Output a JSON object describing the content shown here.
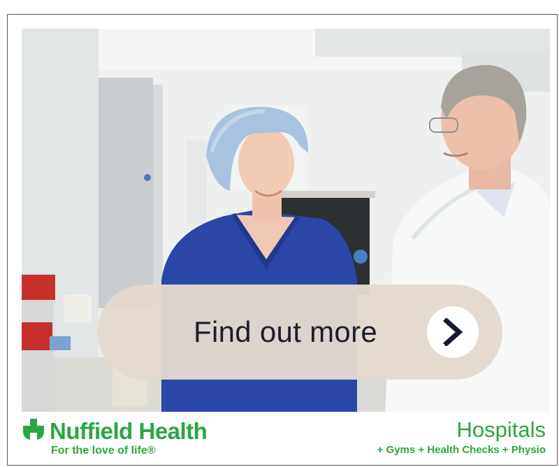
{
  "ad": {
    "cta_label": "Find out more",
    "brand_name": "Nuffield Health",
    "tagline": "For the love of life®",
    "category": "Hospitals",
    "services": "+ Gyms + Health Checks + Physio"
  },
  "icons": {
    "cta_arrow": "chevron-right-icon",
    "logo_mark": "cross-logo-icon"
  },
  "colors": {
    "brand_green": "#2aa741",
    "cta_background": "#e4d8cd",
    "cta_text": "#1b1e2c",
    "nurse_scrubs": "#2b47a8",
    "cap": "#a9c3de"
  }
}
